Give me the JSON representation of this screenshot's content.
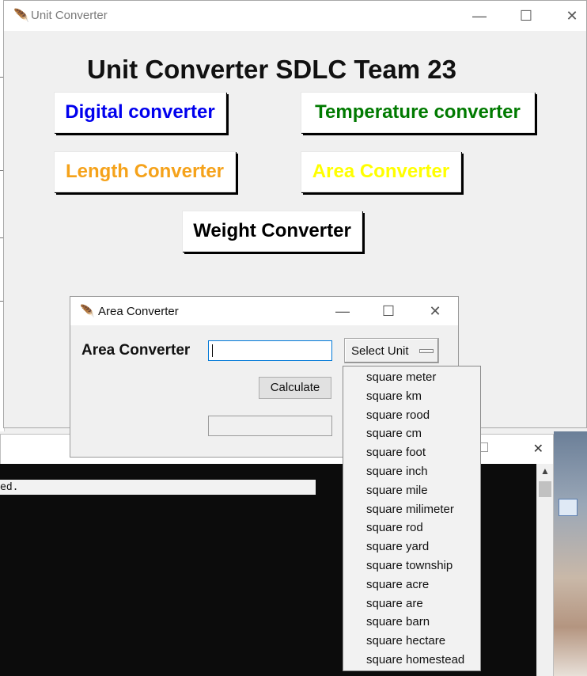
{
  "main_window": {
    "title": "Unit Converter",
    "heading": "Unit Converter SDLC Team 23",
    "controls": {
      "minimize": "—",
      "maximize": "☐",
      "close": "✕"
    },
    "buttons": {
      "digital": {
        "label": "Digital converter",
        "color": "#0000ee"
      },
      "temperature": {
        "label": "Temperature converter",
        "color": "#007a00"
      },
      "length": {
        "label": "Length Converter",
        "color": "#f5a21a"
      },
      "area": {
        "label": "Area Converter",
        "color": "#ffff00"
      },
      "weight": {
        "label": "Weight Converter",
        "color": "#000000"
      }
    }
  },
  "area_window": {
    "title": "Area Converter",
    "controls": {
      "minimize": "—",
      "maximize": "☐",
      "close": "✕"
    },
    "label": "Area Converter",
    "input_value": "",
    "select_label": "Select Unit",
    "calculate_label": "Calculate",
    "result_value": ""
  },
  "dropdown": {
    "items": [
      "square meter",
      "square km",
      "square rood",
      "square cm",
      "square foot",
      "square inch",
      "square mile",
      "square milimeter",
      "square rod",
      "square yard",
      "square township",
      "square acre",
      "square are",
      "square barn",
      "square hectare",
      "square homestead"
    ]
  },
  "console": {
    "line_text": "ed."
  },
  "background_window": {
    "close": "✕",
    "scroll_up": "▲"
  },
  "icons": {
    "app_icon": "feather-icon",
    "desktop_icon": "window-icon"
  }
}
